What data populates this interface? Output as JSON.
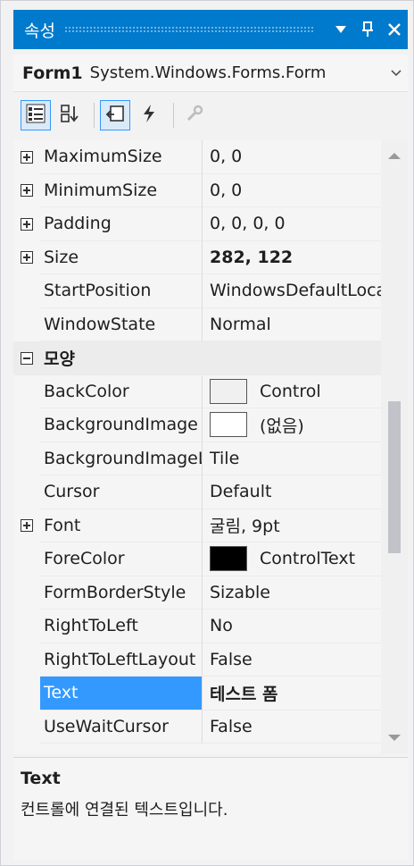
{
  "window": {
    "title": "속성",
    "dropdown_icon": "triangle-down",
    "pin_icon": "pin",
    "close_icon": "close"
  },
  "selector": {
    "object_name": "Form1",
    "object_type": "System.Windows.Forms.Form",
    "dropdown_icon": "chevron-down"
  },
  "toolbar": {
    "buttons": [
      {
        "name": "categorized",
        "icon": "categorized-icon",
        "active": true
      },
      {
        "name": "alphabetical",
        "icon": "sort-alphabetical-icon",
        "active": false
      },
      {
        "name": "properties",
        "icon": "properties-icon",
        "active": true
      },
      {
        "name": "events",
        "icon": "lightning-icon",
        "active": false
      },
      {
        "name": "property-pages",
        "icon": "wrench-icon",
        "active": false,
        "disabled": true
      }
    ]
  },
  "properties": {
    "rows": [
      {
        "name": "MaximumSize",
        "value": "0, 0",
        "expandable": true
      },
      {
        "name": "MinimumSize",
        "value": "0, 0",
        "expandable": true
      },
      {
        "name": "Padding",
        "value": "0, 0, 0, 0",
        "expandable": true
      },
      {
        "name": "Size",
        "value": "282, 122",
        "expandable": true,
        "bold": true
      },
      {
        "name": "StartPosition",
        "value": "WindowsDefaultLocation"
      },
      {
        "name": "WindowState",
        "value": "Normal"
      },
      {
        "name": "모양",
        "category": true
      },
      {
        "name": "BackColor",
        "value": "Control",
        "swatch": "#f0f0f0"
      },
      {
        "name": "BackgroundImage",
        "value": "(없음)",
        "swatch": "#ffffff"
      },
      {
        "name": "BackgroundImageLayout",
        "value": "Tile"
      },
      {
        "name": "Cursor",
        "value": "Default"
      },
      {
        "name": "Font",
        "value": "굴림, 9pt",
        "expandable": true
      },
      {
        "name": "ForeColor",
        "value": "ControlText",
        "swatch": "#000000"
      },
      {
        "name": "FormBorderStyle",
        "value": "Sizable"
      },
      {
        "name": "RightToLeft",
        "value": "No"
      },
      {
        "name": "RightToLeftLayout",
        "value": "False"
      },
      {
        "name": "Text",
        "value": "테스트 폼",
        "bold": true,
        "selected": true
      },
      {
        "name": "UseWaitCursor",
        "value": "False"
      }
    ]
  },
  "description": {
    "title": "Text",
    "text": "컨트롤에 연결된 텍스트입니다."
  },
  "colors": {
    "titlebar": "#007acc",
    "selection": "#3399ff",
    "accent": "#3399ff"
  }
}
